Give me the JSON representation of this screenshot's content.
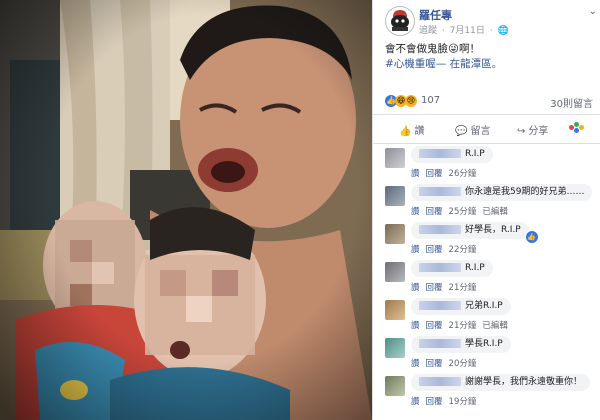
{
  "post": {
    "author": "羅任專",
    "visibility": "追蹤",
    "date": "7月11日",
    "visibility_icon": "globe-icon",
    "caption_line1": "會不會做鬼臉😜啊！",
    "caption_line2": "#心機重喔— 在龍潭區。",
    "reactions_count": "107",
    "shares": "30則留言",
    "colors": {
      "link": "#385898",
      "accent": "#3578e5",
      "meta": "#90949c"
    }
  },
  "actions": {
    "like": "讚",
    "comment": "留言",
    "share": "分享",
    "like_icon": "thumbs-up-icon",
    "comment_icon": "speech-bubble-icon",
    "share_icon": "share-arrow-icon",
    "more_icon": "colorful-dots-icon"
  },
  "comments": [
    {
      "text": "R.I.P",
      "like": "讚",
      "reply": "回覆",
      "time": "26分鐘",
      "edited": "",
      "badge": false
    },
    {
      "text": "你永遠是我59期的好兄弟……",
      "like": "讚",
      "reply": "回覆",
      "time": "25分鐘",
      "edited": "已編輯",
      "badge": false
    },
    {
      "text": "好學長，R.I.P",
      "like": "讚",
      "reply": "回覆",
      "time": "22分鐘",
      "edited": "",
      "badge": true
    },
    {
      "text": "R.I.P",
      "like": "讚",
      "reply": "回覆",
      "time": "21分鐘",
      "edited": "",
      "badge": false
    },
    {
      "text": "兄弟R.I.P",
      "like": "讚",
      "reply": "回覆",
      "time": "21分鐘",
      "edited": "已編輯",
      "badge": false
    },
    {
      "text": "學長R.I.P",
      "like": "讚",
      "reply": "回覆",
      "time": "20分鐘",
      "edited": "",
      "badge": false
    },
    {
      "text": "謝謝學長，我們永遠敬重你！",
      "like": "讚",
      "reply": "回覆",
      "time": "19分鐘",
      "edited": "",
      "badge": false
    }
  ]
}
